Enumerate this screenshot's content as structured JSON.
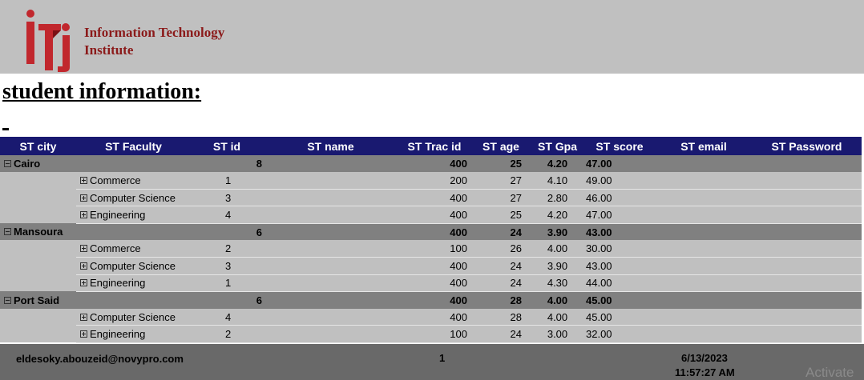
{
  "header": {
    "org_line1": "Information Technology",
    "org_line2": "Institute",
    "logo_colors": {
      "primary": "#c1272d",
      "dark": "#8b1a1a"
    }
  },
  "page_title": "student information:",
  "table": {
    "columns": [
      "ST city",
      "ST Faculty",
      "ST id",
      "ST name",
      "ST Trac id",
      "ST age",
      "ST Gpa",
      "ST score",
      "ST email",
      "ST Password"
    ],
    "groups": [
      {
        "city": "Cairo",
        "id": "8",
        "trac": "400",
        "age": "25",
        "gpa": "4.20",
        "score": "47.00",
        "rows": [
          {
            "faculty": "Commerce",
            "id": "1",
            "trac": "200",
            "age": "27",
            "gpa": "4.10",
            "score": "49.00"
          },
          {
            "faculty": "Computer Science",
            "id": "3",
            "trac": "400",
            "age": "27",
            "gpa": "2.80",
            "score": "46.00"
          },
          {
            "faculty": "Engineering",
            "id": "4",
            "trac": "400",
            "age": "25",
            "gpa": "4.20",
            "score": "47.00"
          }
        ]
      },
      {
        "city": "Mansoura",
        "id": "6",
        "trac": "400",
        "age": "24",
        "gpa": "3.90",
        "score": "43.00",
        "rows": [
          {
            "faculty": "Commerce",
            "id": "2",
            "trac": "100",
            "age": "26",
            "gpa": "4.00",
            "score": "30.00"
          },
          {
            "faculty": "Computer Science",
            "id": "3",
            "trac": "400",
            "age": "24",
            "gpa": "3.90",
            "score": "43.00"
          },
          {
            "faculty": "Engineering",
            "id": "1",
            "trac": "400",
            "age": "24",
            "gpa": "4.30",
            "score": "44.00"
          }
        ]
      },
      {
        "city": "Port Said",
        "id": "6",
        "trac": "400",
        "age": "28",
        "gpa": "4.00",
        "score": "45.00",
        "rows": [
          {
            "faculty": "Computer Science",
            "id": "4",
            "trac": "400",
            "age": "28",
            "gpa": "4.00",
            "score": "45.00"
          },
          {
            "faculty": "Engineering",
            "id": "2",
            "trac": "100",
            "age": "24",
            "gpa": "3.00",
            "score": "32.00"
          }
        ]
      }
    ]
  },
  "footer": {
    "email": "eldesoky.abouzeid@novypro.com",
    "page": "1",
    "date": "6/13/2023",
    "time": "11:57:27 AM"
  },
  "watermark": "Activate",
  "colors": {
    "header_band": "#c0c0c0",
    "table_header": "#191970",
    "group_row": "#808080",
    "detail_row": "#c0c0c0",
    "footer_band": "#696969"
  }
}
